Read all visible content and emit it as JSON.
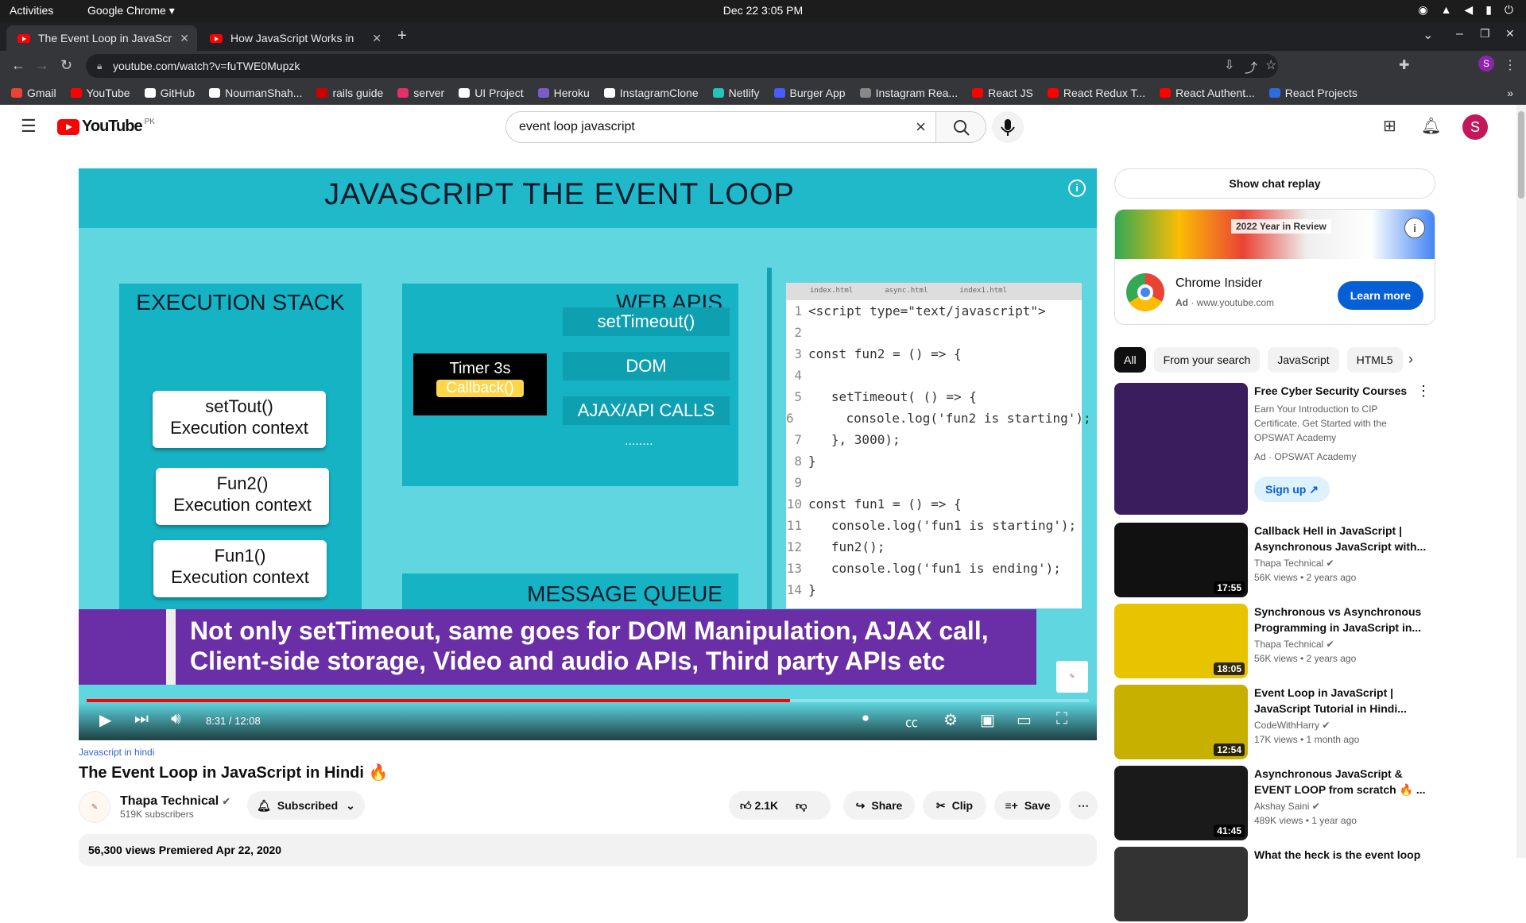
{
  "system": {
    "activities": "Activities",
    "app": "Google Chrome ▾",
    "clock": "Dec 22  3:05 PM"
  },
  "tabs": [
    {
      "title": "The Event Loop in JavaScr"
    },
    {
      "title": "How JavaScript Works in"
    }
  ],
  "address": {
    "url": "youtube.com/watch?v=fuTWE0Mupzk"
  },
  "bookmarks": [
    {
      "label": "Gmail",
      "color": "#ea4335"
    },
    {
      "label": "YouTube",
      "color": "#ff0000"
    },
    {
      "label": "GitHub",
      "color": "#ffffff"
    },
    {
      "label": "NoumanShah...",
      "color": "#ffffff"
    },
    {
      "label": "rails guide",
      "color": "#cc0000"
    },
    {
      "label": "server",
      "color": "#e1306c"
    },
    {
      "label": "UI Project",
      "color": "#ffffff"
    },
    {
      "label": "Heroku",
      "color": "#7b5dc7"
    },
    {
      "label": "InstagramClone",
      "color": "#ffffff"
    },
    {
      "label": "Netlify",
      "color": "#20c6b7"
    },
    {
      "label": "Burger App",
      "color": "#4a5cff"
    },
    {
      "label": "Instagram Rea...",
      "color": "#888888"
    },
    {
      "label": "React JS",
      "color": "#ff0000"
    },
    {
      "label": "React Redux T...",
      "color": "#ff0000"
    },
    {
      "label": "React Authent...",
      "color": "#ff0000"
    },
    {
      "label": "React Projects",
      "color": "#2d6cdf"
    }
  ],
  "youtube": {
    "region": "PK",
    "logo_text": "YouTube",
    "search_value": "event loop javascript",
    "avatar_letter": "S"
  },
  "video": {
    "slide_title": "JAVASCRIPT THE EVENT LOOP",
    "stack_title": "EXECUTION STACK",
    "stack_items": [
      "setTout()",
      "Execution context",
      "Fun2()",
      "Execution context",
      "Fun1()",
      "Execution context"
    ],
    "webapi_title": "WEB APIS",
    "timer_label": "Timer 3s",
    "callback_label": "Callback()",
    "apis": [
      "setTimeout()",
      "DOM",
      "AJAX/API CALLS"
    ],
    "dots": "........",
    "queue_title": "MESSAGE QUEUE",
    "code_tabs": [
      "index.html",
      "async.html",
      "index1.html"
    ],
    "code_lines": [
      "<script type=\"text/javascript\">",
      "",
      "const fun2 = () => {",
      "",
      "   setTimeout( () => {",
      "      console.log('fun2 is starting');",
      "   }, 3000);",
      "}",
      "",
      "const fun1 = () => {",
      "   console.log('fun1 is starting');",
      "   fun2();",
      "   console.log('fun1 is ending');",
      "}"
    ],
    "caption_line1": "Not only setTimeout, same goes for DOM Manipulation, AJAX call,",
    "caption_line2": "Client-side storage,  Video and audio APIs, Third party APIs etc",
    "time": "8:31 / 12:08",
    "progress_fraction": 0.702
  },
  "meta": {
    "category": "Javascript in hindi",
    "title": "The Event Loop in JavaScript in Hindi 🔥",
    "channel": "Thapa Technical",
    "subscribers": "519K subscribers",
    "subscribed": "Subscribed",
    "likes": "2.1K",
    "share": "Share",
    "clip": "Clip",
    "save": "Save",
    "views_date": "56,300 views  Premiered Apr 22, 2020"
  },
  "sidebar": {
    "chat_replay": "Show chat replay",
    "ad": {
      "banner": "2022 Year in Review",
      "name": "Chrome Insider",
      "ad_label": "Ad",
      "domain": "www.youtube.com",
      "cta": "Learn more"
    },
    "chips": [
      "All",
      "From your search",
      "JavaScript",
      "HTML5"
    ],
    "recommendations": [
      {
        "title": "Free Cyber Security Courses",
        "channel": "Earn Your Introduction to CIP Certificate. Get Started with the OPSWAT Academy",
        "meta": "Ad · OPSWAT Academy",
        "cta": "Sign up",
        "thumb": "#3a1d5c"
      },
      {
        "title": "Callback Hell in JavaScript | Asynchronous JavaScript with...",
        "channel": "Thapa Technical ✔",
        "meta": "56K views • 2 years ago",
        "duration": "17:55",
        "thumb": "#111111"
      },
      {
        "title": "Synchronous vs Asynchronous Programming in JavaScript in...",
        "channel": "Thapa Technical ✔",
        "meta": "56K views • 2 years ago",
        "duration": "18:05",
        "thumb": "#e8c400"
      },
      {
        "title": "Event Loop in JavaScript | JavaScript Tutorial in Hindi...",
        "channel": "CodeWithHarry ✔",
        "meta": "17K views • 1 month ago",
        "duration": "12:54",
        "thumb": "#c8b000"
      },
      {
        "title": "Asynchronous JavaScript & EVENT LOOP from scratch 🔥 ...",
        "channel": "Akshay Saini ✔",
        "meta": "489K views • 1 year ago",
        "duration": "41:45",
        "thumb": "#1a1a1a"
      },
      {
        "title": "What the heck is the event loop",
        "channel": "",
        "meta": "",
        "thumb": "#333333"
      }
    ]
  }
}
